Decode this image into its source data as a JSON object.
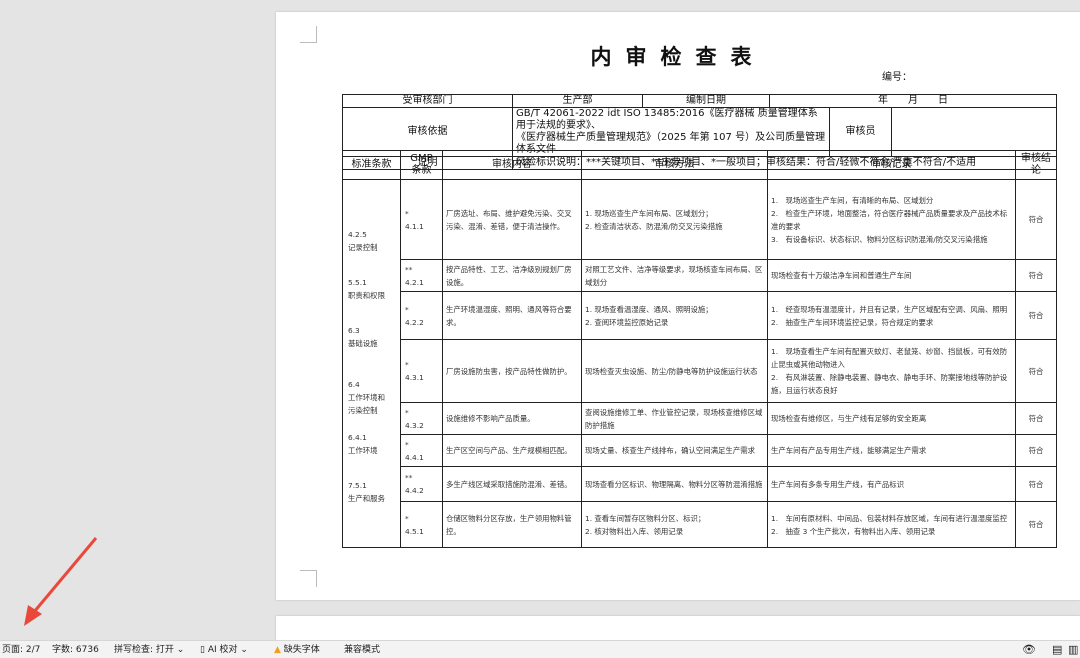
{
  "document": {
    "title": "内审检查表",
    "number_label": "编号："
  },
  "header": {
    "dept_label": "受审核部门",
    "dept_value": "生产部",
    "date_label": "编制日期",
    "date_value": "年　　月　　日",
    "basis_label": "审核依据",
    "basis_line1": "GB/T 42061-2022 idt ISO 13485:2016《医疗器械 质量管理体系 用于法规的要求》、",
    "basis_line2": "《医疗器械生产质量管理规范》（2025 年第 107 号）及公司质量管理体系文件",
    "auditor_label": "审核员",
    "note_label": "说明",
    "note_value": "风险标识说明：***关键项目、**主要项目、*一般项目；审核结果：符合/轻微不符合/严重不符合/不适用"
  },
  "columns": [
    "标准条款",
    "GMP\n条款",
    "审核内容",
    "审核方法",
    "审核记录",
    "审核结\n论"
  ],
  "clauses": {
    "g1_line1": "4.2.5",
    "g1_line2": "记录控制",
    "g2_line1": "5.5.1",
    "g2_line2": "职责和权限",
    "g3_line1": "6.3",
    "g3_line2": "基础设施",
    "g4_line1": "6.4",
    "g4_line2": "工作环境和",
    "g4_line3": "污染控制",
    "g5_line1": "6.4.1",
    "g5_line2": "工作环境",
    "g6_line1": "7.5.1",
    "g6_line2": "生产和服务"
  },
  "rows": [
    {
      "stars": "*",
      "gmp": "4.1.1",
      "content": "厂房选址、布局、维护避免污染、交叉污染、混淆、差错，便于清洁操作。",
      "method": [
        "1. 现场巡查生产车间布局、区域划分；",
        "2. 检查清洁状态、防混淆/防交叉污染措施"
      ],
      "record": [
        "1.　现场巡查生产车间，有清晰的布局、区域划分",
        "2.　检查生产环境，地面整洁，符合医疗器械产品质量要求及产品技术标准的要求",
        "3.　有设备标识、状态标识、物料分区标识防混淆/防交叉污染措施"
      ],
      "result": "符合"
    },
    {
      "stars": "**",
      "gmp": "4.2.1",
      "content": "按产品特性、工艺、洁净级别规划厂房设施。",
      "method": [
        "对照工艺文件、洁净等级要求，现场核查车间布局、区域划分"
      ],
      "record": [
        "现场检查有十万级洁净车间和普通生产车间"
      ],
      "result": "符合"
    },
    {
      "stars": "*",
      "gmp": "4.2.2",
      "content": "生产环境温湿度、照明、通风等符合要求。",
      "method": [
        "1. 现场查看温湿度、通风、照明设施；",
        "2. 查阅环境监控原始记录"
      ],
      "record": [
        "1.　经查现场有温湿度计，并且有记录，生产区域配有空调、风扇、照明",
        "2.　抽查生产车间环境监控记录，符合规定的要求"
      ],
      "result": "符合"
    },
    {
      "stars": "*",
      "gmp": "4.3.1",
      "content": "厂房设施防虫害，按产品特性做防护。",
      "method": [
        "现场检查灭虫设施、防尘/防静电等防护设施运行状态"
      ],
      "record": [
        "1.　现场查看生产车间有配置灭蚊灯、老鼠笼、纱窗、挡鼠板，可有效防止昆虫或其他动物进入",
        "2.　有风淋装置、除静电装置、静电衣、静电手环、防案接地线等防护设施，且运行状态良好"
      ],
      "result": "符合"
    },
    {
      "stars": "*",
      "gmp": "4.3.2",
      "content": "设施维修不影响产品质量。",
      "method": [
        "查阅设施维修工单、作业管控记录，现场核查维修区域防护措施"
      ],
      "record": [
        "现场检查有维修区，与生产线有足够的安全距离"
      ],
      "result": "符合"
    },
    {
      "stars": "*",
      "gmp": "4.4.1",
      "content": "生产区空间与产品、生产规模相匹配。",
      "method": [
        "现场丈量、核查生产线排布，确认空间满足生产需求"
      ],
      "record": [
        "生产车间有产品专用生产线，能够满足生产需求"
      ],
      "result": "符合"
    },
    {
      "stars": "**",
      "gmp": "4.4.2",
      "content": "多生产线区域采取措施防混淆、差错。",
      "method": [
        "现场查看分区标识、物理隔离、物料分区等防混淆措施"
      ],
      "record": [
        "生产车间有多条专用生产线，有产品标识"
      ],
      "result": "符合"
    },
    {
      "stars": "*",
      "gmp": "4.5.1",
      "content": "仓储区物料分区存放，生产领用物料管控。",
      "method": [
        "1. 查看车间暂存区物料分区、标识；",
        "2. 核对物料出入库、领用记录"
      ],
      "record": [
        "1.　车间有原材料、中间品、包装材料存放区域，车间有进行温湿度监控",
        "2.　抽查 3 个生产批次，有物料出入库、领用记录"
      ],
      "result": "符合"
    }
  ],
  "statusbar": {
    "page": "页面: 2/7",
    "words": "字数: 6736",
    "spell": "拼写检查: 打开",
    "ai_check": "AI 校对",
    "missing_font": "缺失字体",
    "compat": "兼容模式"
  },
  "colors": {
    "arrow": "#e8493a",
    "warning": "#f0a020"
  }
}
